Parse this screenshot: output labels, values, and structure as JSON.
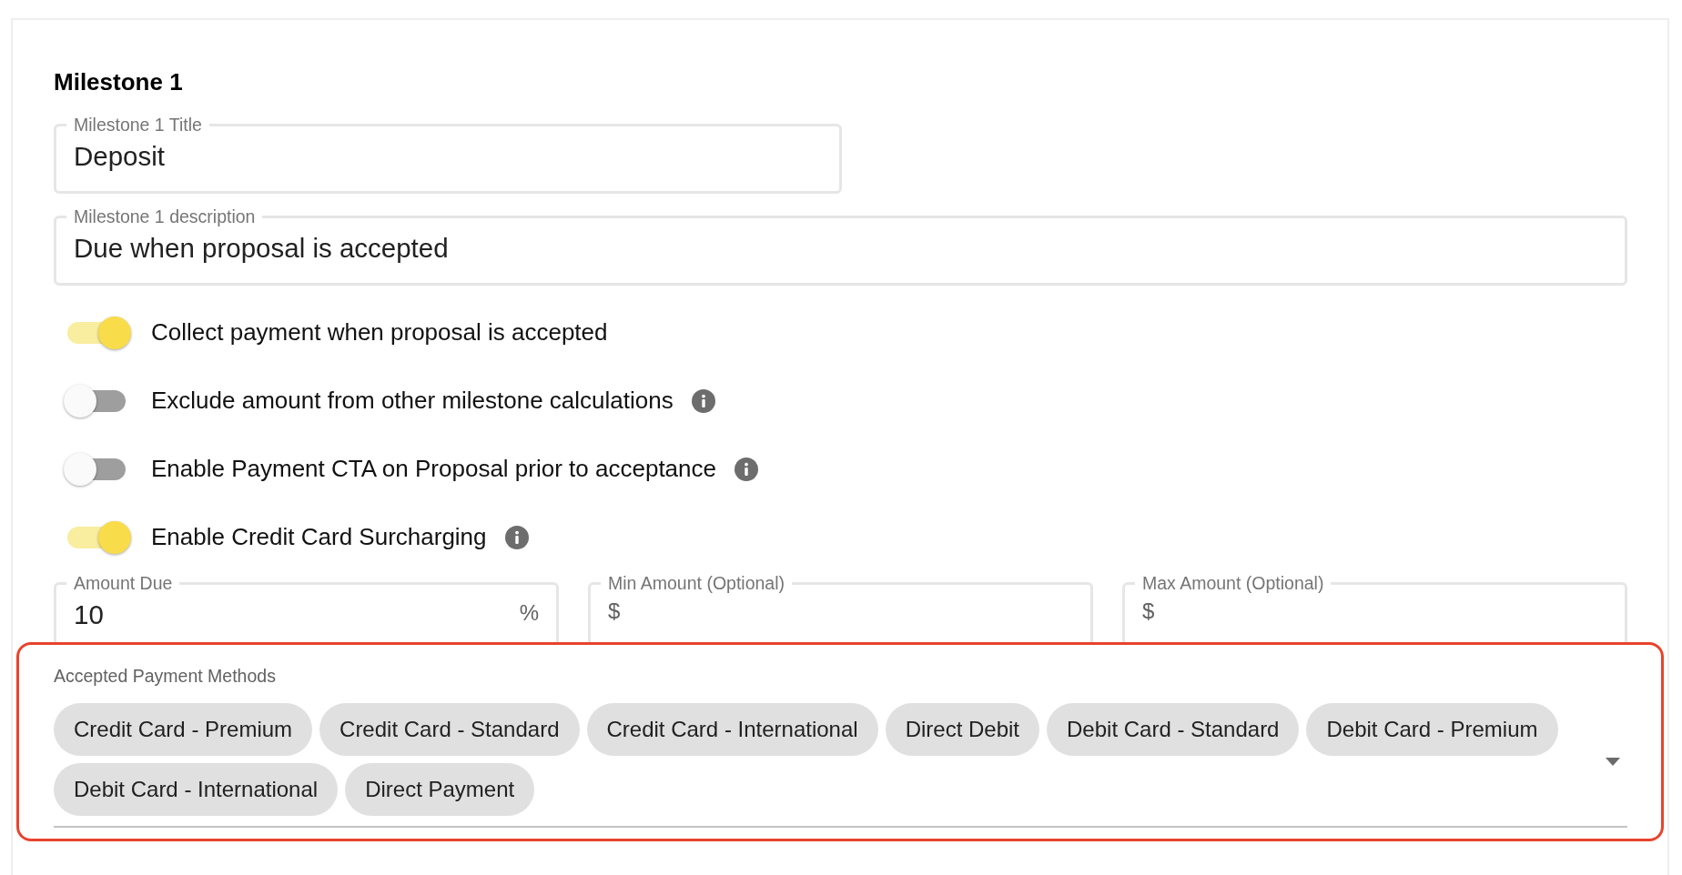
{
  "heading": "Milestone 1",
  "title_field": {
    "label": "Milestone 1 Title",
    "value": "Deposit"
  },
  "description_field": {
    "label": "Milestone 1 description",
    "value": "Due when proposal is accepted"
  },
  "toggles": [
    {
      "label": "Collect payment when proposal is accepted",
      "on": true,
      "info": false
    },
    {
      "label": "Exclude amount from other milestone calculations",
      "on": false,
      "info": true
    },
    {
      "label": "Enable Payment CTA on Proposal prior to acceptance",
      "on": false,
      "info": true
    },
    {
      "label": "Enable Credit Card Surcharging",
      "on": true,
      "info": true
    }
  ],
  "amount_fields": [
    {
      "label": "Amount Due",
      "value": "10",
      "suffix": "%"
    },
    {
      "label": "Min Amount (Optional)",
      "prefix": "$"
    },
    {
      "label": "Max Amount (Optional)",
      "prefix": "$"
    }
  ],
  "payment_methods": {
    "label": "Accepted Payment Methods",
    "highlighted": true,
    "chips": [
      "Credit Card - Premium",
      "Credit Card - Standard",
      "Credit Card - International",
      "Direct Debit",
      "Debit Card - Standard",
      "Debit Card - Premium",
      "Debit Card - International",
      "Direct Payment"
    ]
  }
}
